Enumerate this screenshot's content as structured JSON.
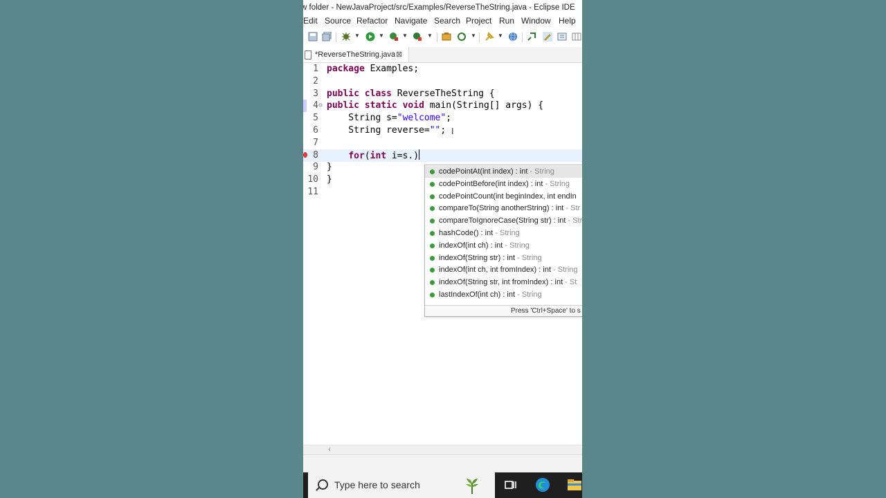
{
  "window": {
    "title": "w folder - NewJavaProject/src/Examples/ReverseTheString.java - Eclipse IDE"
  },
  "menu": [
    {
      "label": "Edit"
    },
    {
      "label": "Source"
    },
    {
      "label": "Refactor"
    },
    {
      "label": "Navigate"
    },
    {
      "label": "Search"
    },
    {
      "label": "Project"
    },
    {
      "label": "Run"
    },
    {
      "label": "Window"
    },
    {
      "label": "Help"
    }
  ],
  "toolbar_icons": [
    "save-icon",
    "save-all-icon",
    "debug-icon",
    "run-icon",
    "run-last-tool-icon",
    "new-java-class-icon",
    "open-type-icon",
    "refresh-icon",
    "pin-icon",
    "globe-icon",
    "search-icon",
    "highlight-icon",
    "perspective-icon"
  ],
  "editor_tab": {
    "label": "*ReverseTheString.java",
    "close": "⊠"
  },
  "code_lines": [
    {
      "n": "1",
      "parts": [
        {
          "t": "package",
          "c": "kw"
        },
        {
          "t": " Examples;",
          "c": ""
        }
      ]
    },
    {
      "n": "2",
      "parts": []
    },
    {
      "n": "3",
      "parts": [
        {
          "t": "public",
          "c": "kw"
        },
        {
          "t": " ",
          "c": ""
        },
        {
          "t": "class",
          "c": "kw"
        },
        {
          "t": " ReverseTheString {",
          "c": ""
        }
      ]
    },
    {
      "n": "4",
      "parts": [
        {
          "t": "public",
          "c": "kw"
        },
        {
          "t": " ",
          "c": ""
        },
        {
          "t": "static",
          "c": "kw"
        },
        {
          "t": " ",
          "c": ""
        },
        {
          "t": "void",
          "c": "kw"
        },
        {
          "t": " main(String[] args) {",
          "c": ""
        }
      ]
    },
    {
      "n": "5",
      "parts": [
        {
          "t": "    String s=",
          "c": ""
        },
        {
          "t": "\"welcome\"",
          "c": "str"
        },
        {
          "t": ";",
          "c": ""
        }
      ]
    },
    {
      "n": "6",
      "parts": [
        {
          "t": "    String reverse=",
          "c": ""
        },
        {
          "t": "\"\"",
          "c": "str"
        },
        {
          "t": ";",
          "c": ""
        }
      ]
    },
    {
      "n": "7",
      "parts": []
    },
    {
      "n": "8",
      "parts": [
        {
          "t": "    ",
          "c": ""
        },
        {
          "t": "for",
          "c": "kw"
        },
        {
          "t": "(",
          "c": ""
        },
        {
          "t": "int",
          "c": "kw"
        },
        {
          "t": " i=s.)",
          "c": ""
        }
      ]
    },
    {
      "n": "9",
      "parts": [
        {
          "t": "}",
          "c": ""
        }
      ]
    },
    {
      "n": "10",
      "parts": [
        {
          "t": "}",
          "c": ""
        }
      ]
    },
    {
      "n": "11",
      "parts": []
    }
  ],
  "autocomplete": {
    "items": [
      {
        "sig": "codePointAt(int index) : int",
        "owner": " - String"
      },
      {
        "sig": "codePointBefore(int index) : int",
        "owner": " - String"
      },
      {
        "sig": "codePointCount(int beginIndex, int endIn",
        "owner": ""
      },
      {
        "sig": "compareTo(String anotherString) : int",
        "owner": " - Str"
      },
      {
        "sig": "compareToIgnoreCase(String str) : int",
        "owner": " - Str"
      },
      {
        "sig": "hashCode() : int",
        "owner": " - String"
      },
      {
        "sig": "indexOf(int ch) : int",
        "owner": " - String"
      },
      {
        "sig": "indexOf(String str) : int",
        "owner": " - String"
      },
      {
        "sig": "indexOf(int ch, int fromIndex) : int",
        "owner": " - String"
      },
      {
        "sig": "indexOf(String str, int fromIndex) : int",
        "owner": " - St"
      },
      {
        "sig": "lastIndexOf(int ch) : int",
        "owner": " - String"
      }
    ],
    "footer": "Press 'Ctrl+Space' to s"
  },
  "taskbar": {
    "search_placeholder": "Type here to search"
  },
  "colors": {
    "keyword": "#7f0055",
    "string": "#2a00ff",
    "method_dot": "#3a9b3a",
    "background": "#5b868c"
  }
}
